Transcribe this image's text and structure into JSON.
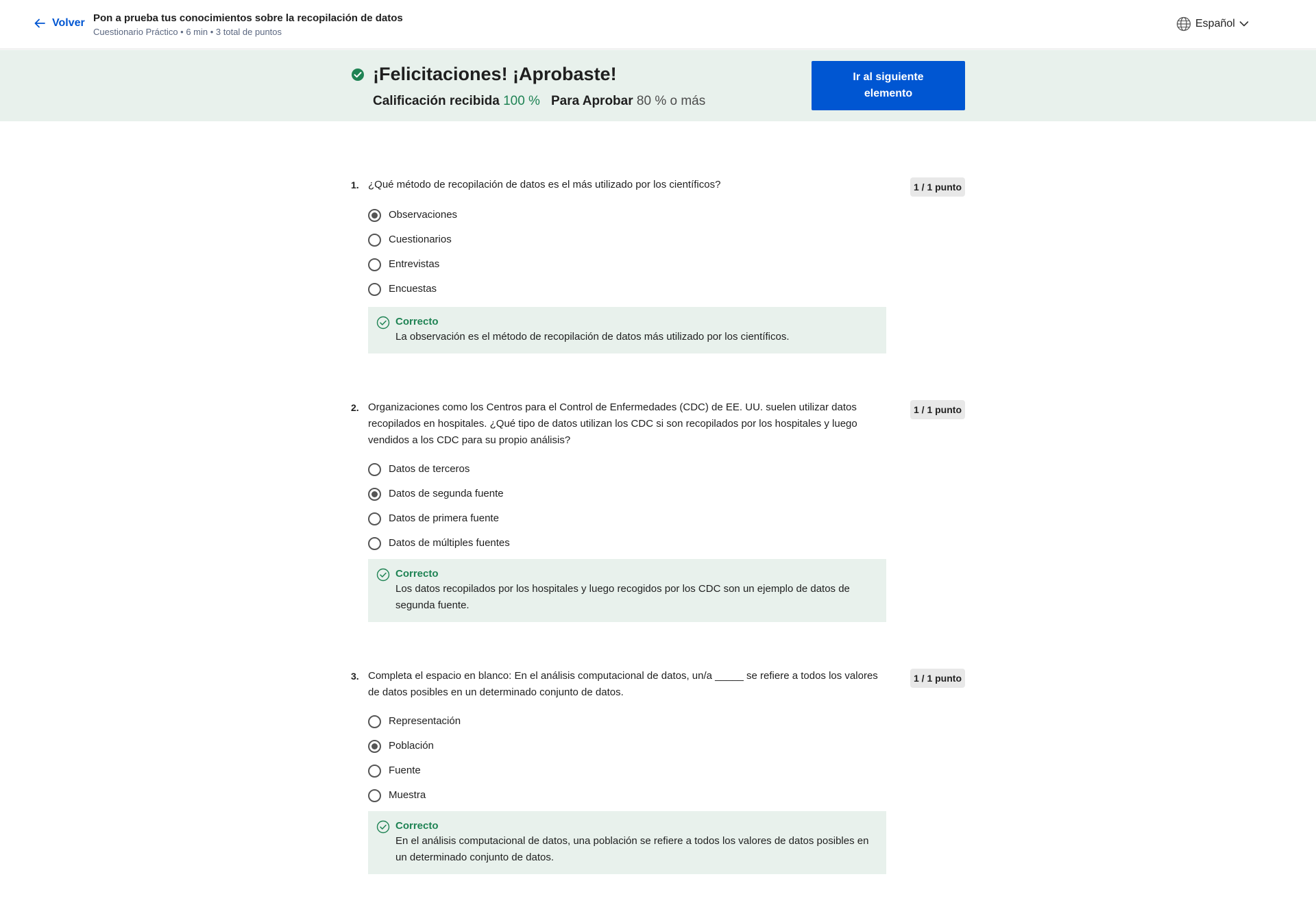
{
  "header": {
    "back_label": "Volver",
    "title": "Pon a prueba tus conocimientos sobre la recopilación de datos",
    "meta": "Cuestionario Práctico • 6 min • 3 total de puntos",
    "language": "Español"
  },
  "banner": {
    "title": "¡Felicitaciones! ¡Aprobaste!",
    "grade_label": "Calificación recibida",
    "grade_value": "100 %",
    "pass_label": "Para Aprobar",
    "pass_value": "80 % o más",
    "next_button": "Ir al siguiente elemento"
  },
  "colors": {
    "accent": "#0056d2",
    "success": "#1f8354",
    "banner_bg": "#e8f1ec"
  },
  "questions": [
    {
      "number": "1.",
      "text": "¿Qué método de recopilación de datos es el más utilizado por los científicos?",
      "points": "1 / 1 punto",
      "options": [
        {
          "label": "Observaciones",
          "selected": true
        },
        {
          "label": "Cuestionarios",
          "selected": false
        },
        {
          "label": "Entrevistas",
          "selected": false
        },
        {
          "label": "Encuestas",
          "selected": false
        }
      ],
      "feedback_title": "Correcto",
      "feedback_text": "La observación es el método de recopilación de datos más utilizado por los científicos."
    },
    {
      "number": "2.",
      "text": "Organizaciones como los Centros para el Control de Enfermedades (CDC) de EE. UU. suelen utilizar datos recopilados en hospitales. ¿Qué tipo de datos utilizan los CDC si son recopilados por los hospitales y luego vendidos a los CDC para su propio análisis?",
      "points": "1 / 1 punto",
      "options": [
        {
          "label": "Datos de terceros",
          "selected": false
        },
        {
          "label": "Datos de segunda fuente",
          "selected": true
        },
        {
          "label": "Datos de primera fuente",
          "selected": false
        },
        {
          "label": "Datos de múltiples fuentes",
          "selected": false
        }
      ],
      "feedback_title": "Correcto",
      "feedback_text": "Los datos recopilados por los hospitales y luego recogidos por los CDC son un ejemplo de datos de segunda fuente."
    },
    {
      "number": "3.",
      "text": "Completa el espacio en blanco: En el análisis computacional de datos, un/a _____ se refiere a todos los valores de datos posibles en un determinado conjunto de datos.",
      "points": "1 / 1 punto",
      "options": [
        {
          "label": "Representación",
          "selected": false
        },
        {
          "label": "Población",
          "selected": true
        },
        {
          "label": "Fuente",
          "selected": false
        },
        {
          "label": "Muestra",
          "selected": false
        }
      ],
      "feedback_title": "Correcto",
      "feedback_text": "En el análisis computacional de datos, una población se refiere a todos los valores de datos posibles en un determinado conjunto de datos."
    }
  ]
}
